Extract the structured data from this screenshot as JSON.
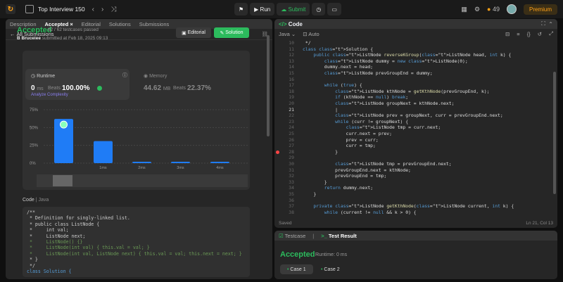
{
  "top": {
    "title": "Top Interview 150",
    "run": "Run",
    "submit": "Submit",
    "streak": "49",
    "premium": "Premium"
  },
  "left": {
    "tabs": [
      "Description",
      "Accepted",
      "Editorial",
      "Solutions",
      "Submissions"
    ],
    "back": "All Submissions",
    "status": "Accepted",
    "testcases": "62 / 62 testcases passed",
    "author": "B Bruceiee",
    "submitted": "submitted at Feb 18, 2025 09:13",
    "editorial_btn": "Editorial",
    "solution_btn": "Solution",
    "runtime_label": "Runtime",
    "runtime_value": "0",
    "runtime_unit": "ms",
    "beats_label": "Beats",
    "runtime_beats": "100.00%",
    "analyze": "Analyze Complexity",
    "memory_label": "Memory",
    "memory_value": "44.62",
    "memory_unit": "MB",
    "memory_beats": "22.37%",
    "code_label": "Code",
    "lang": "Java",
    "code_lines": [
      "/**",
      " * Definition for singly-linked list.",
      " * public class ListNode {",
      " *     int val;",
      " *     ListNode next;",
      " *     ListNode() {}",
      " *     ListNode(int val) { this.val = val; }",
      " *     ListNode(int val, ListNode next) { this.val = val; this.next = next; }",
      " * }",
      " */",
      "class Solution {"
    ]
  },
  "chart_data": {
    "type": "bar",
    "categories": [
      "",
      "1ms",
      "2ms",
      "3ms",
      "4ms"
    ],
    "values": [
      62,
      31,
      2,
      2,
      2
    ],
    "y_ticks": [
      "75%",
      "50%",
      "25%",
      "0%"
    ],
    "ylim": [
      0,
      75
    ],
    "highlight": 0
  },
  "right": {
    "title": "Code",
    "lang": "Java",
    "mode": "Auto",
    "saved": "Saved",
    "cursor": "Ln 21, Col 13",
    "line_numbers": [
      10,
      11,
      12,
      13,
      14,
      15,
      16,
      17,
      18,
      19,
      20,
      21,
      22,
      23,
      24,
      25,
      26,
      27,
      28,
      29,
      30,
      31,
      32,
      33,
      34,
      35,
      36,
      37,
      38
    ],
    "lines": [
      " */",
      "class Solution {",
      "    public ListNode reverseKGroup(ListNode head, int k) {",
      "        ListNode dummy = new ListNode(0);",
      "        dummy.next = head;",
      "        ListNode prevGroupEnd = dummy;",
      "",
      "        while (true) {",
      "            ListNode kthNode = getKthNode(prevGroupEnd, k);",
      "            if (kthNode == null) break;",
      "            ListNode groupNext = kthNode.next;",
      "            |",
      "            ListNode prev = groupNext, curr = prevGroupEnd.next;",
      "            while (curr != groupNext) {",
      "                ListNode tmp = curr.next;",
      "                curr.next = prev;",
      "                prev = curr;",
      "                curr = tmp;",
      "            }",
      "",
      "            ListNode tmp = prevGroupEnd.next;",
      "            prevGroupEnd.next = kthNode;",
      "            prevGroupEnd = tmp;",
      "        }",
      "        return dummy.next;",
      "    }",
      "",
      "    private ListNode getKthNode(ListNode current, int k) {",
      "        while (current != null && k > 0) {"
    ]
  },
  "bottom": {
    "tabs": [
      "Testcase",
      "Test Result"
    ],
    "status": "Accepted",
    "runtime": "Runtime: 0 ms",
    "cases": [
      "Case 1",
      "Case 2"
    ]
  }
}
